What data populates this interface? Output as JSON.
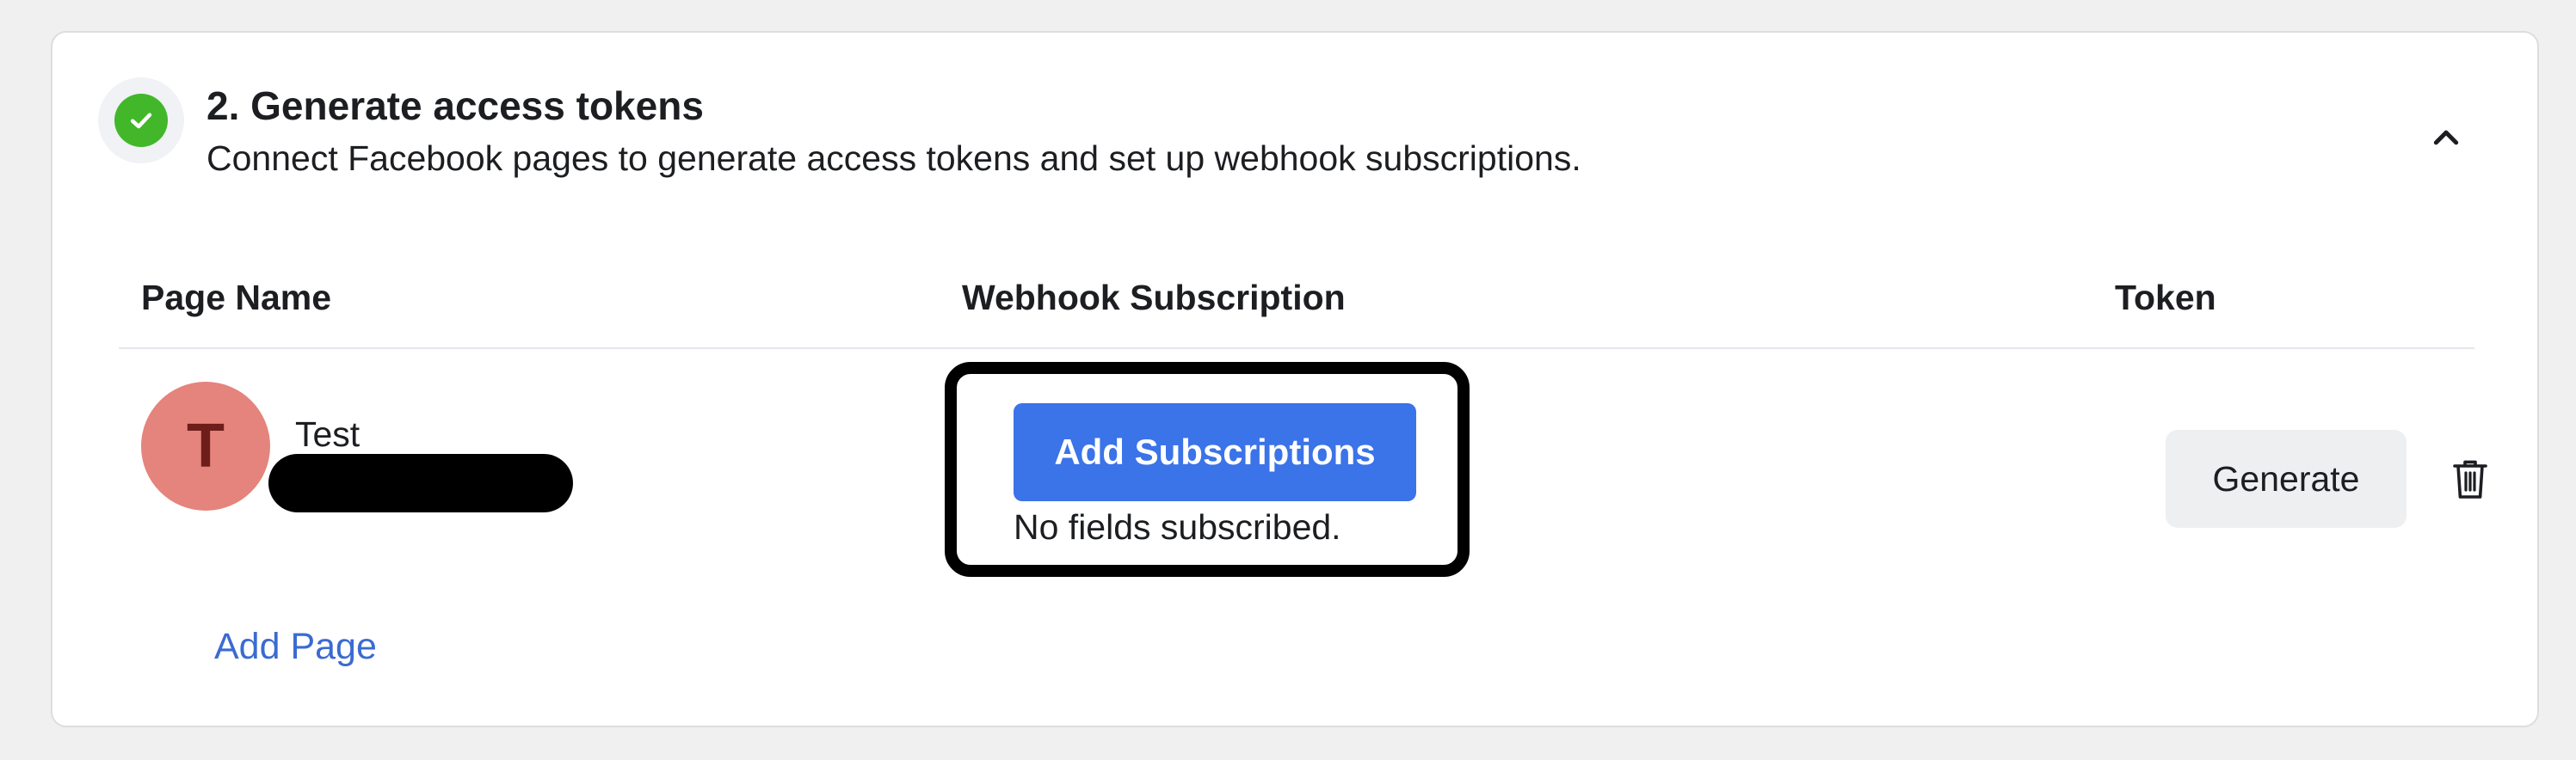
{
  "step": {
    "title": "2. Generate access tokens",
    "description": "Connect Facebook pages to generate access tokens and set up webhook subscriptions.",
    "status_icon": "check-circle-icon",
    "toggle_icon": "chevron-up-icon"
  },
  "table": {
    "headers": {
      "page_name": "Page Name",
      "webhook_subscription": "Webhook Subscription",
      "token": "Token"
    },
    "rows": [
      {
        "avatar_letter": "T",
        "page_name": "Test",
        "add_subscriptions_label": "Add Subscriptions",
        "subscription_status": "No fields subscribed.",
        "generate_label": "Generate",
        "delete_icon": "trash-icon"
      }
    ]
  },
  "add_page_label": "Add Page",
  "colors": {
    "accent_blue": "#3b73e8",
    "link_blue": "#3b6bd1",
    "success_green": "#42b72a",
    "avatar_bg": "#e4847c"
  }
}
